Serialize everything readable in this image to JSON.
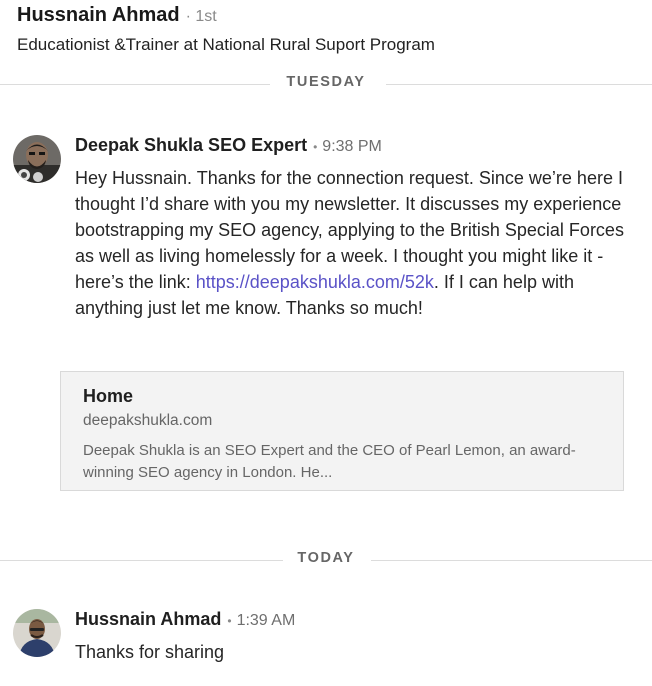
{
  "conversation_header": {
    "name": "Hussnain Ahmad",
    "degree": "1st",
    "headline": "Educationist &Trainer at National Rural Suport Program"
  },
  "dividers": {
    "tuesday": "TUESDAY",
    "today": "TODAY"
  },
  "messages": [
    {
      "sender": "Deepak Shukla SEO Expert",
      "separator": "•",
      "time": "9:38 PM",
      "text_before_link": "Hey Hussnain. Thanks for the connection request. Since we’re here I thought I’d share with you my newsletter. It discusses my experience bootstrapping my SEO agency, applying to the British Special Forces as well as living homelessly for a week. I thought you might like it - here’s the link: ",
      "link": "https://deepakshukla.com/52k",
      "text_after_link": ". If I can help with anything just let me know. Thanks so much!",
      "preview": {
        "title": "Home",
        "domain": "deepakshukla.com",
        "description": "Deepak Shukla is an SEO Expert and the CEO of Pearl Lemon, an award-winning SEO agency in London. He..."
      }
    },
    {
      "sender": "Hussnain Ahmad",
      "separator": "•",
      "time": "1:39 AM",
      "text": "Thanks for sharing"
    }
  ],
  "colors": {
    "link": "#5a52c7",
    "divider_text": "#666666",
    "preview_bg": "#f3f3f3"
  }
}
